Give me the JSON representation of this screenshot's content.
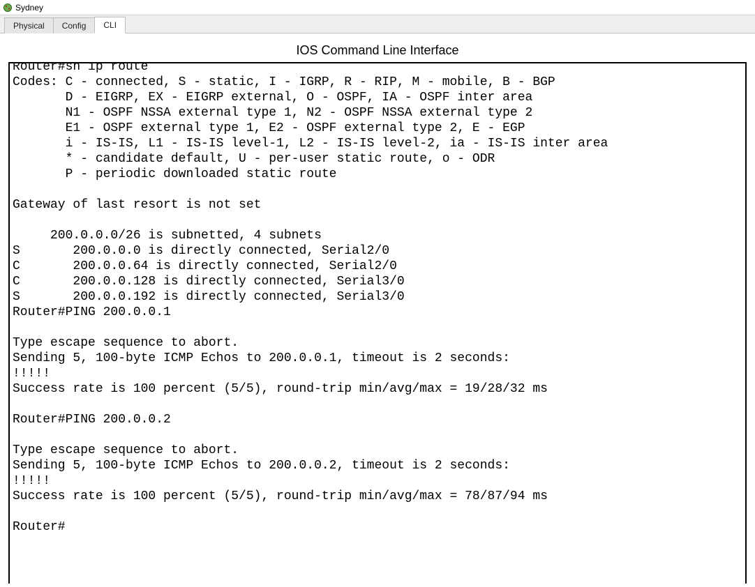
{
  "window": {
    "title": "Sydney"
  },
  "tabs": [
    {
      "label": "Physical",
      "active": false
    },
    {
      "label": "Config",
      "active": false
    },
    {
      "label": "CLI",
      "active": true
    }
  ],
  "panel": {
    "title": "IOS Command Line Interface"
  },
  "terminal": {
    "lines": [
      "Router#sh ip route",
      "Codes: C - connected, S - static, I - IGRP, R - RIP, M - mobile, B - BGP",
      "       D - EIGRP, EX - EIGRP external, O - OSPF, IA - OSPF inter area",
      "       N1 - OSPF NSSA external type 1, N2 - OSPF NSSA external type 2",
      "       E1 - OSPF external type 1, E2 - OSPF external type 2, E - EGP",
      "       i - IS-IS, L1 - IS-IS level-1, L2 - IS-IS level-2, ia - IS-IS inter area",
      "       * - candidate default, U - per-user static route, o - ODR",
      "       P - periodic downloaded static route",
      "",
      "Gateway of last resort is not set",
      "",
      "     200.0.0.0/26 is subnetted, 4 subnets",
      "S       200.0.0.0 is directly connected, Serial2/0",
      "C       200.0.0.64 is directly connected, Serial2/0",
      "C       200.0.0.128 is directly connected, Serial3/0",
      "S       200.0.0.192 is directly connected, Serial3/0",
      "Router#PING 200.0.0.1",
      "",
      "Type escape sequence to abort.",
      "Sending 5, 100-byte ICMP Echos to 200.0.0.1, timeout is 2 seconds:",
      "!!!!!",
      "Success rate is 100 percent (5/5), round-trip min/avg/max = 19/28/32 ms",
      "",
      "Router#PING 200.0.0.2",
      "",
      "Type escape sequence to abort.",
      "Sending 5, 100-byte ICMP Echos to 200.0.0.2, timeout is 2 seconds:",
      "!!!!!",
      "Success rate is 100 percent (5/5), round-trip min/avg/max = 78/87/94 ms",
      "",
      "Router#"
    ]
  }
}
